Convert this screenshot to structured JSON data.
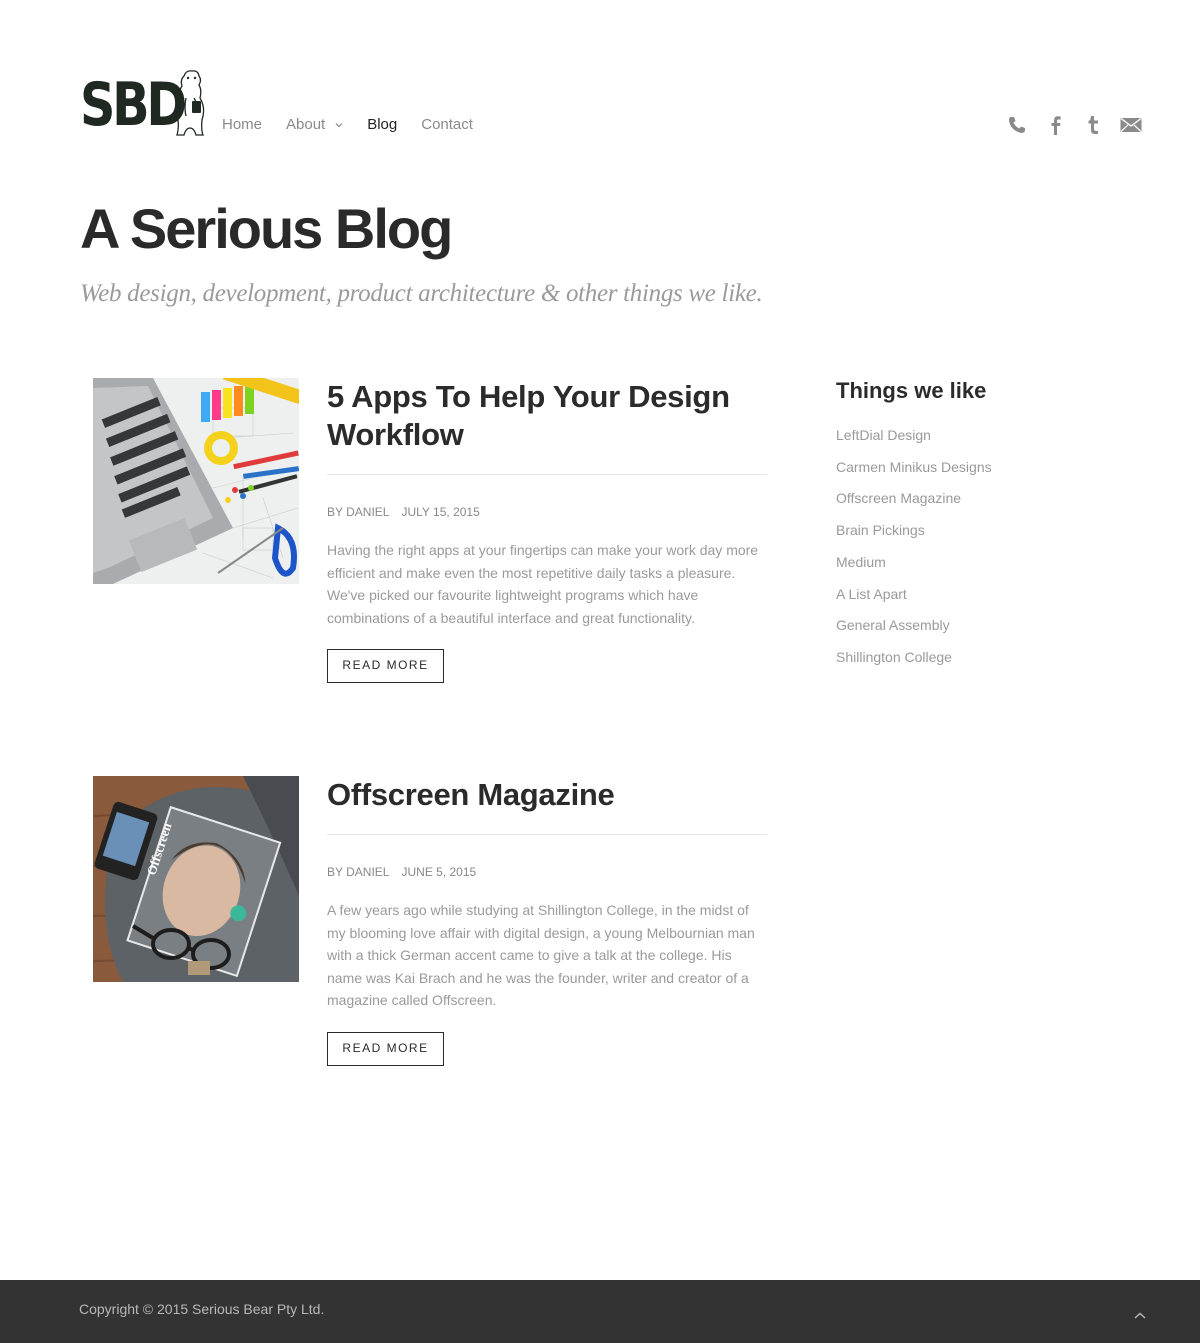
{
  "brand": {
    "logo_text": "SBD"
  },
  "nav": {
    "items": [
      {
        "label": "Home"
      },
      {
        "label": "About"
      },
      {
        "label": "Blog"
      },
      {
        "label": "Contact"
      }
    ],
    "active": "Blog"
  },
  "social": [
    "phone-icon",
    "facebook-icon",
    "tumblr-icon",
    "email-icon"
  ],
  "hero": {
    "title": "A Serious Blog",
    "subtitle": "Web design, development, product architecture & other things we like."
  },
  "posts": [
    {
      "title": "5 Apps To Help Your Design Workflow",
      "author": "BY DANIEL",
      "date": "JULY 15, 2015",
      "excerpt": "Having the right apps at your fingertips can make your work day more efficient and make even the most repetitive daily tasks a pleasure. We've picked our favourite lightweight programs which have combinations of a beautiful interface and great functionality.",
      "button": "READ MORE"
    },
    {
      "title": "Offscreen Magazine",
      "author": "BY DANIEL",
      "date": "JUNE 5, 2015",
      "excerpt": "A few years ago while studying at Shillington College, in the midst of my blooming love affair with digital design, a young Melbournian man with a thick German accent came to give a talk at the college. His name was Kai Brach and he was the founder, writer and creator of a magazine called Offscreen.",
      "button": "READ MORE",
      "image_text": "Offscreen"
    }
  ],
  "sidebar": {
    "title": "Things we like",
    "links": [
      "LeftDial Design",
      "Carmen Minikus Designs",
      "Offscreen Magazine",
      "Brain Pickings",
      "Medium",
      "A List Apart",
      "General Assembly",
      "Shillington College"
    ]
  },
  "footer": {
    "copyright": "Copyright © 2015 Serious Bear Pty Ltd."
  },
  "colors": {
    "text": "#2b2b2b",
    "muted": "#9a9a9a",
    "footer_bg": "#333334"
  }
}
